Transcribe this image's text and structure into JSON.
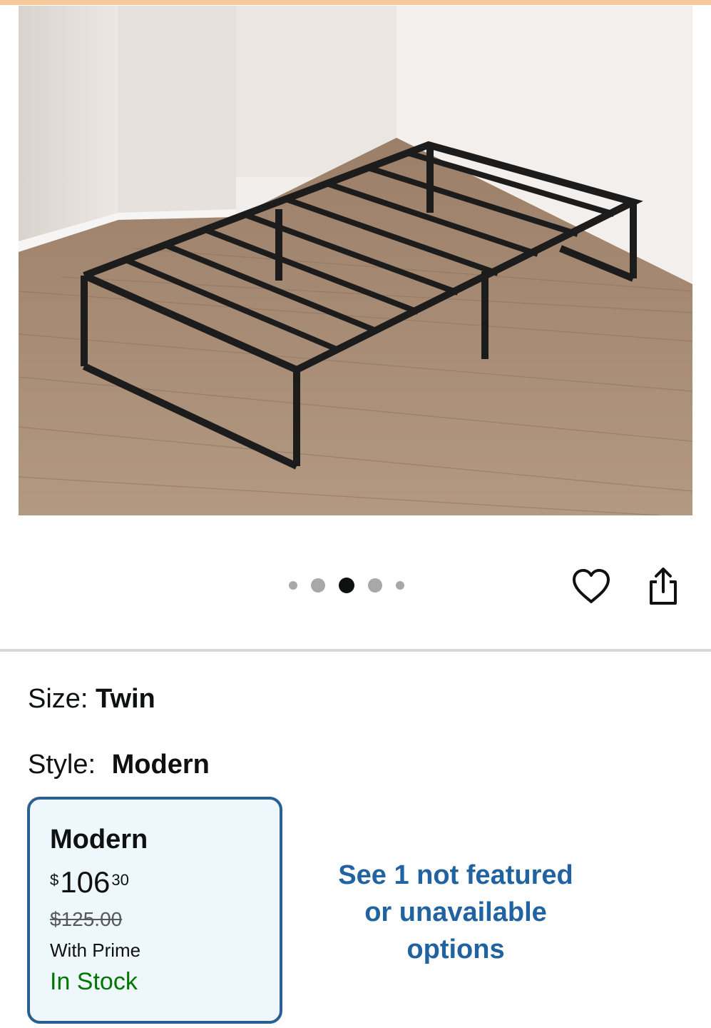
{
  "hero": {
    "image_alt": "Black metal platform bed frame on wood floor",
    "carousel": {
      "count": 5,
      "active_index": 2
    }
  },
  "actions": {
    "wishlist_icon": "heart-icon",
    "share_icon": "share-icon"
  },
  "selections": {
    "size_label": "Size:",
    "size_value": "Twin",
    "style_label": "Style:",
    "style_value": "Modern"
  },
  "variant": {
    "name": "Modern",
    "currency": "$",
    "price_whole": "106",
    "price_fraction": "30",
    "list_price": "$125.00",
    "prime_text": "With Prime",
    "stock_text": "In Stock"
  },
  "more_options": {
    "line1": "See 1 not featured",
    "line2": "or unavailable",
    "line3": "options"
  },
  "colors": {
    "accent_border": "#2a5f94",
    "link": "#2162a1",
    "in_stock": "#007600",
    "card_bg": "#eef7fc",
    "top_strip": "#f6c89a"
  }
}
